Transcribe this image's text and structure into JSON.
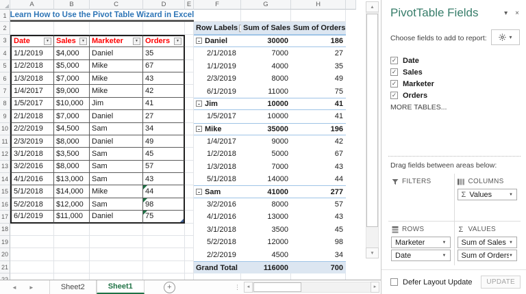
{
  "icons": {
    "close": "×",
    "dropdown": "▾",
    "filter_dropdown": "▼",
    "up_arrow": "▲",
    "down_arrow": "▼",
    "left_arrow": "◄",
    "right_arrow": "►",
    "check": "✓",
    "sigma": "Σ",
    "collapse": "-",
    "ellipsis": "⋮",
    "add": "+"
  },
  "colors": {
    "title_blue": "#2E75B6",
    "header_red": "#FF0000",
    "pivot_fill": "#DCE6F1",
    "pivot_border": "#9DC3E6",
    "excel_green": "#217346",
    "pane_title_green": "#377D6A",
    "flag_green": "#1E7145"
  },
  "sheet": {
    "columns": [
      "A",
      "B",
      "C",
      "D",
      "E",
      "F",
      "G",
      "H"
    ],
    "visible_rows": 22,
    "title": "Learn How to Use the Pivot Table Wizard in Excel",
    "data_table": {
      "headers": [
        "Date",
        "Sales",
        "Marketer",
        "Orders"
      ],
      "rows": [
        [
          "1/1/2019",
          "$4,000",
          "Daniel",
          "35"
        ],
        [
          "1/2/2018",
          "$5,000",
          "Mike",
          "67"
        ],
        [
          "1/3/2018",
          "$7,000",
          "Mike",
          "43"
        ],
        [
          "1/4/2017",
          "$9,000",
          "Mike",
          "42"
        ],
        [
          "1/5/2017",
          "$10,000",
          "Jim",
          "41"
        ],
        [
          "2/1/2018",
          "$7,000",
          "Daniel",
          "27"
        ],
        [
          "2/2/2019",
          "$4,500",
          "Sam",
          "34"
        ],
        [
          "2/3/2019",
          "$8,000",
          "Daniel",
          "49"
        ],
        [
          "3/1/2018",
          "$3,500",
          "Sam",
          "45"
        ],
        [
          "3/2/2016",
          "$8,000",
          "Sam",
          "57"
        ],
        [
          "4/1/2016",
          "$13,000",
          "Sam",
          "43"
        ],
        [
          "5/1/2018",
          "$14,000",
          "Mike",
          "44"
        ],
        [
          "5/2/2018",
          "$12,000",
          "Sam",
          "98"
        ],
        [
          "6/1/2019",
          "$11,000",
          "Daniel",
          "75"
        ]
      ],
      "flagged_rows": [
        11,
        12,
        13
      ]
    },
    "pivot_table": {
      "headers": [
        "Row Labels",
        "Sum of Sales",
        "Sum of Orders"
      ],
      "rows": [
        {
          "label": "Daniel",
          "sales": "30000",
          "orders": "186",
          "type": "group"
        },
        {
          "label": "2/1/2018",
          "sales": "7000",
          "orders": "27",
          "type": "item"
        },
        {
          "label": "1/1/2019",
          "sales": "4000",
          "orders": "35",
          "type": "item"
        },
        {
          "label": "2/3/2019",
          "sales": "8000",
          "orders": "49",
          "type": "item"
        },
        {
          "label": "6/1/2019",
          "sales": "11000",
          "orders": "75",
          "type": "item"
        },
        {
          "label": "Jim",
          "sales": "10000",
          "orders": "41",
          "type": "group"
        },
        {
          "label": "1/5/2017",
          "sales": "10000",
          "orders": "41",
          "type": "item"
        },
        {
          "label": "Mike",
          "sales": "35000",
          "orders": "196",
          "type": "group"
        },
        {
          "label": "1/4/2017",
          "sales": "9000",
          "orders": "42",
          "type": "item"
        },
        {
          "label": "1/2/2018",
          "sales": "5000",
          "orders": "67",
          "type": "item"
        },
        {
          "label": "1/3/2018",
          "sales": "7000",
          "orders": "43",
          "type": "item"
        },
        {
          "label": "5/1/2018",
          "sales": "14000",
          "orders": "44",
          "type": "item"
        },
        {
          "label": "Sam",
          "sales": "41000",
          "orders": "277",
          "type": "group"
        },
        {
          "label": "3/2/2016",
          "sales": "8000",
          "orders": "57",
          "type": "item"
        },
        {
          "label": "4/1/2016",
          "sales": "13000",
          "orders": "43",
          "type": "item"
        },
        {
          "label": "3/1/2018",
          "sales": "3500",
          "orders": "45",
          "type": "item"
        },
        {
          "label": "5/2/2018",
          "sales": "12000",
          "orders": "98",
          "type": "item"
        },
        {
          "label": "2/2/2019",
          "sales": "4500",
          "orders": "34",
          "type": "item"
        },
        {
          "label": "Grand Total",
          "sales": "116000",
          "orders": "700",
          "type": "total"
        }
      ]
    },
    "tabs": [
      "Sheet2",
      "Sheet1"
    ],
    "active_tab": "Sheet1"
  },
  "panel": {
    "title": "PivotTable Fields",
    "choose_fields_label": "Choose fields to add to report:",
    "fields": [
      {
        "label": "Date",
        "checked": true
      },
      {
        "label": "Sales",
        "checked": true
      },
      {
        "label": "Marketer",
        "checked": true
      },
      {
        "label": "Orders",
        "checked": true
      }
    ],
    "more_tables_label": "MORE TABLES...",
    "drag_fields_label": "Drag fields between areas below:",
    "areas": {
      "filters": {
        "label": "FILTERS",
        "items": []
      },
      "columns": {
        "label": "COLUMNS",
        "items": [
          {
            "label": "Values",
            "sigma": true
          }
        ]
      },
      "rows": {
        "label": "ROWS",
        "items": [
          {
            "label": "Marketer"
          },
          {
            "label": "Date"
          }
        ]
      },
      "values": {
        "label": "VALUES",
        "items": [
          {
            "label": "Sum of Sales"
          },
          {
            "label": "Sum of Orders"
          }
        ]
      }
    },
    "defer_layout_label": "Defer Layout Update",
    "defer_checked": false,
    "update_button_label": "UPDATE"
  }
}
